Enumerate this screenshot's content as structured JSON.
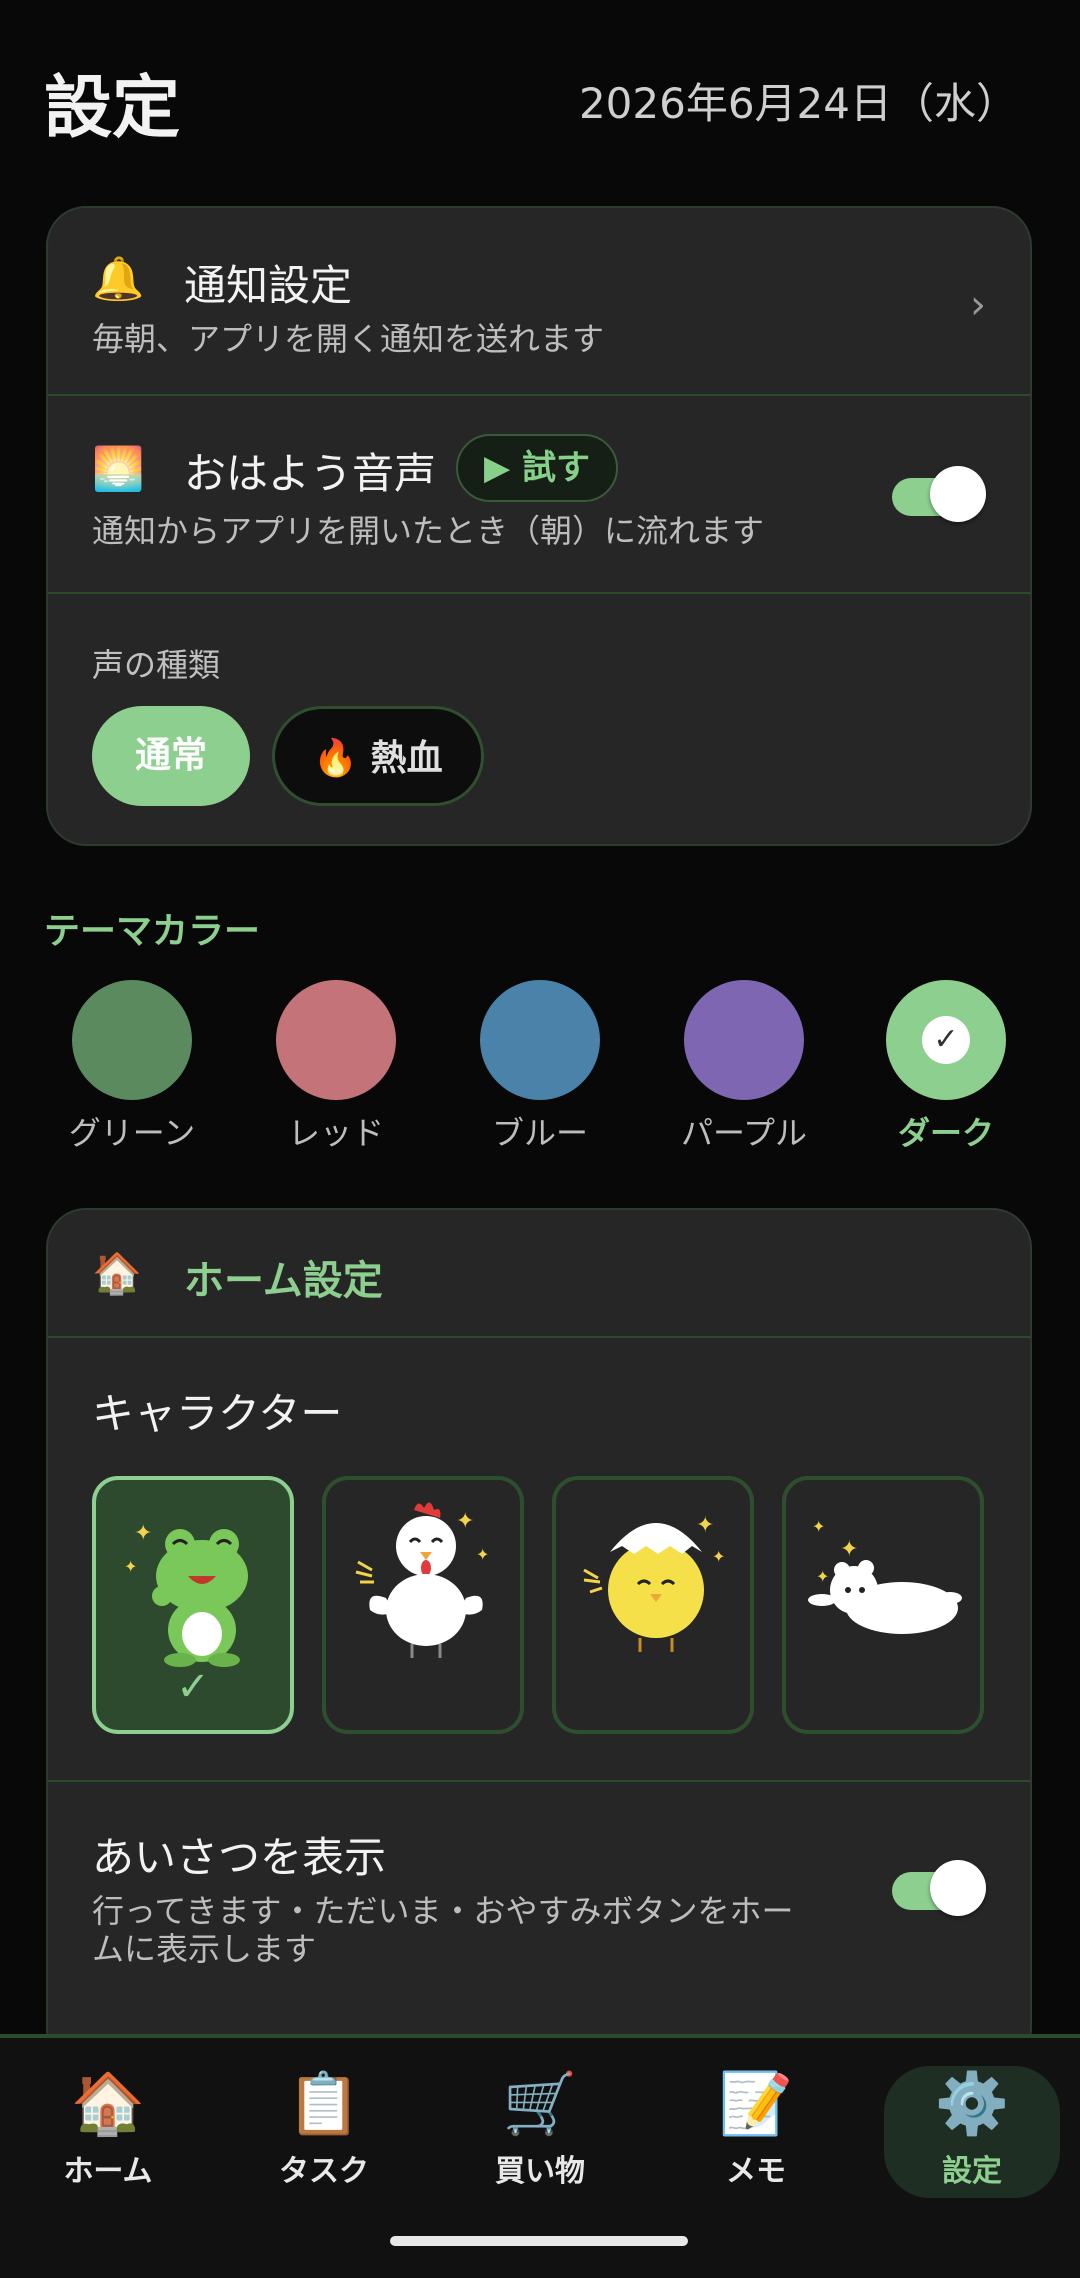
{
  "header": {
    "title": "設定",
    "date": "2026年6月24日（水）"
  },
  "notification": {
    "icon": "🔔",
    "title": "通知設定",
    "subtitle": "毎朝、アプリを開く通知を送れます",
    "chevron": "›"
  },
  "morning_voice": {
    "icon": "🌅",
    "title": "おはよう音声",
    "try_label": "▶ 試す",
    "subtitle": "通知からアプリを開いたとき（朝）に流れます",
    "enabled": true
  },
  "voice_type": {
    "label": "声の種類",
    "options": [
      "通常",
      "🔥 熱血"
    ],
    "selected": "通常"
  },
  "theme": {
    "heading": "テーマカラー",
    "options": [
      {
        "label": "グリーン",
        "color": "#5a8a5e"
      },
      {
        "label": "レッド",
        "color": "#c47378"
      },
      {
        "label": "ブルー",
        "color": "#4a82aa"
      },
      {
        "label": "パープル",
        "color": "#7f66b3"
      },
      {
        "label": "ダーク",
        "color": "#8ccf8e"
      }
    ],
    "selected": "ダーク",
    "check": "✓"
  },
  "home_settings": {
    "icon": "🏠",
    "title": "ホーム設定",
    "character_heading": "キャラクター",
    "characters": [
      "frog",
      "rooster",
      "chick",
      "polar-bear"
    ],
    "selected_character": "frog",
    "check": "✓",
    "greeting": {
      "title": "あいさつを表示",
      "subtitle_line1": "行ってきます・ただいま・おやすみボタンをホー",
      "subtitle_line2": "ムに表示します",
      "enabled": true
    }
  },
  "bottom_nav": {
    "items": [
      {
        "icon": "🏠",
        "label": "ホーム"
      },
      {
        "icon": "📋",
        "label": "タスク"
      },
      {
        "icon": "🛒",
        "label": "買い物"
      },
      {
        "icon": "📝",
        "label": "メモ"
      },
      {
        "icon": "⚙️",
        "label": "設定"
      }
    ],
    "active": "設定"
  }
}
